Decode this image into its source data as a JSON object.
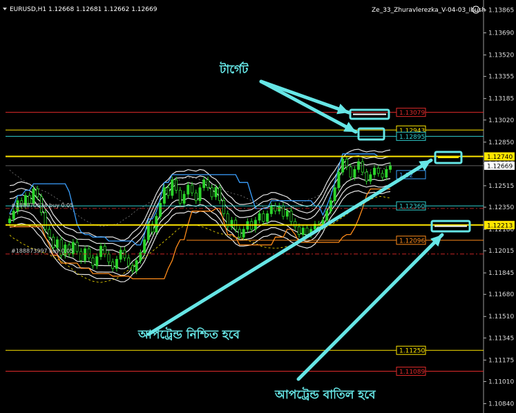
{
  "window": {
    "symbol_info": "EURUSD,H1  1.12668 1.12681 1.12662 1.12669",
    "indicator_title": "Ze_33_Zhuravlerezka_V-04-03_Ibush",
    "smiley_icon": "smiley-icon",
    "dropdown_icon": "triangle-down-icon"
  },
  "colors": {
    "background": "#000000",
    "candle": "#2bd42b",
    "envelope": "#ffffff",
    "callout": "#66e6e6",
    "support": "#ffe600",
    "resistance": "#e22b2b",
    "orange": "#ff8c1a",
    "blue": "#3aa0ff",
    "cyan": "#30d0d0"
  },
  "annotations": {
    "target": "টার্গেট",
    "uptrend_confirmed": "আপট্রেন্ড নিশ্চিত হবে",
    "uptrend_cancelled": "আপট্রেন্ড বাতিল হবে"
  },
  "chart_data": {
    "type": "candlestick",
    "symbol": "EURUSD",
    "timeframe": "H1",
    "ohlc": {
      "open": 1.12668,
      "high": 1.12681,
      "low": 1.12662,
      "close": 1.12669
    },
    "ylim": [
      1.108,
      1.139
    ],
    "y_ticks": [
      1.13865,
      1.1369,
      1.1352,
      1.13355,
      1.13185,
      1.1302,
      1.1285,
      1.12685,
      1.12515,
      1.1235,
      1.1218,
      1.12015,
      1.11845,
      1.1168,
      1.1151,
      1.11345,
      1.11175,
      1.1101,
      1.1084
    ],
    "price_labels": [
      {
        "value": 1.13079,
        "text": "1.13079",
        "kind": "resistance"
      },
      {
        "value": 1.12943,
        "text": "1.12943",
        "kind": "support"
      },
      {
        "value": 1.12895,
        "text": "1.12895",
        "kind": "cyan"
      },
      {
        "value": 1.1274,
        "text": "1.12740",
        "kind": "support-filled"
      },
      {
        "value": 1.12669,
        "text": "1.12669",
        "kind": "current"
      },
      {
        "value": 1.126,
        "text": "1.12",
        "kind": "blue"
      },
      {
        "value": 1.1236,
        "text": "1.12360",
        "kind": "cyan"
      },
      {
        "value": 1.12213,
        "text": "1.12213",
        "kind": "support-filled"
      },
      {
        "value": 1.12096,
        "text": "1.12096",
        "kind": "orange"
      },
      {
        "value": 1.1125,
        "text": "1.11250",
        "kind": "support"
      },
      {
        "value": 1.11089,
        "text": "1.11089",
        "kind": "resistance"
      }
    ],
    "order_labels": [
      {
        "text": "#188870634 buy 0.05",
        "value": 1.1234
      },
      {
        "text": "#188873997 buy 0.05",
        "value": 1.1199
      }
    ],
    "series": [
      {
        "name": "EURUSD H1",
        "close": [
          1.1226,
          1.1232,
          1.124,
          1.1236,
          1.1244,
          1.1238,
          1.1249,
          1.1243,
          1.1231,
          1.1218,
          1.1212,
          1.1204,
          1.121,
          1.1198,
          1.1206,
          1.1199,
          1.1208,
          1.1201,
          1.1194,
          1.1203,
          1.1196,
          1.119,
          1.1197,
          1.1205,
          1.1199,
          1.1193,
          1.1188,
          1.1195,
          1.1202,
          1.1196,
          1.119,
          1.1186,
          1.1194,
          1.12,
          1.121,
          1.1222,
          1.1216,
          1.1228,
          1.1238,
          1.125,
          1.1244,
          1.1256,
          1.1248,
          1.1238,
          1.1245,
          1.1252,
          1.1246,
          1.124,
          1.125,
          1.1256,
          1.125,
          1.1243,
          1.125,
          1.124,
          1.123,
          1.122,
          1.1225,
          1.1218,
          1.1212,
          1.1218,
          1.1224,
          1.1218,
          1.1225,
          1.123,
          1.1224,
          1.123,
          1.1236,
          1.1232,
          1.1236,
          1.1228,
          1.1232,
          1.1224,
          1.122,
          1.1214,
          1.1219,
          1.1214,
          1.1218,
          1.1222,
          1.122,
          1.1225,
          1.1232,
          1.124,
          1.125,
          1.1262,
          1.1272,
          1.1266,
          1.1258,
          1.1264,
          1.127,
          1.1262,
          1.1255,
          1.126,
          1.1265,
          1.1261,
          1.1258,
          1.1264,
          1.1267
        ]
      }
    ]
  }
}
